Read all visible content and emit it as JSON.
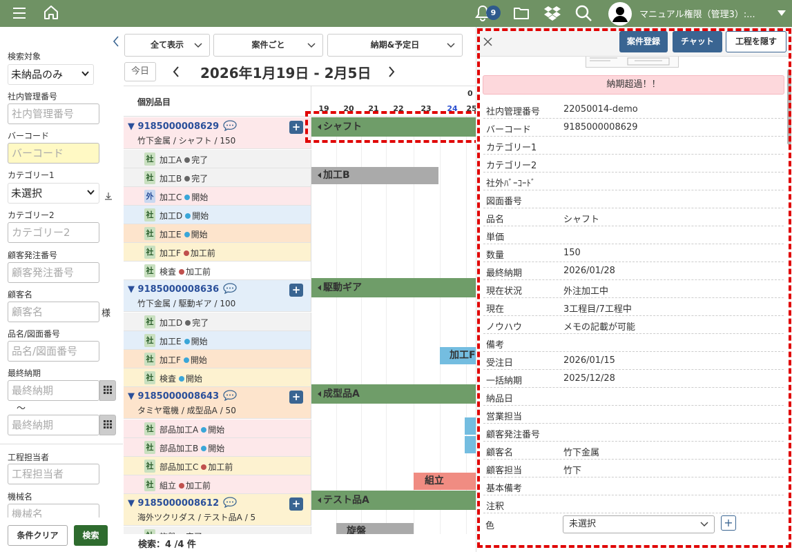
{
  "topbar": {
    "notification_count": "9",
    "user_name": "マニュアル権限（管理3）:..."
  },
  "sidebar": {
    "search_target_label": "検索対象",
    "search_target_value": "未納品のみ",
    "internal_no_label": "社内管理番号",
    "internal_no_placeholder": "社内管理番号",
    "barcode_label": "バーコード",
    "barcode_placeholder": "バーコード",
    "category1_label": "カテゴリー1",
    "category1_value": "未選択",
    "category2_label": "カテゴリー2",
    "category2_placeholder": "カテゴリー2",
    "customer_order_label": "顧客発注番号",
    "customer_order_placeholder": "顧客発注番号",
    "customer_name_label": "顧客名",
    "customer_name_placeholder": "顧客名",
    "customer_suffix": "様",
    "product_label": "品名/図面番号",
    "product_placeholder": "品名/図面番号",
    "deadline_label": "最終納期",
    "deadline_from_placeholder": "最終納期",
    "range_sep": "～",
    "deadline_to_placeholder": "最終納期",
    "process_owner_label": "工程担当者",
    "process_owner_placeholder": "工程担当者",
    "machine_label": "機械名",
    "machine_placeholder": "機械名",
    "clear_button": "条件クリア",
    "search_button": "検索"
  },
  "filters": {
    "show_all": "全て表示",
    "per_project": "案件ごと",
    "deadline_sched": "納期&予定日"
  },
  "calendar": {
    "today_button": "今日",
    "date_range": "2026年1月19日 - 2月5日",
    "days": [
      "19",
      "20",
      "21",
      "22",
      "23",
      "24",
      "25"
    ],
    "header_label": "個別品目",
    "month_hint": "0"
  },
  "gantt": {
    "products": [
      {
        "id": "9185000008629",
        "desc": "竹下金属 / シャフト / 150",
        "bar": "シャフト",
        "steps": [
          {
            "tag": "社",
            "name": "加工A",
            "status": "完了"
          },
          {
            "tag": "社",
            "name": "加工B",
            "status": "完了"
          },
          {
            "tag": "外",
            "name": "加工C",
            "status": "開始"
          },
          {
            "tag": "社",
            "name": "加工D",
            "status": "開始"
          },
          {
            "tag": "社",
            "name": "加工E",
            "status": "開始"
          },
          {
            "tag": "社",
            "name": "加工F",
            "status": "加工前"
          },
          {
            "tag": "社",
            "name": "検査",
            "status": "加工前"
          }
        ]
      },
      {
        "id": "9185000008636",
        "desc": "竹下金属 / 駆動ギア / 100",
        "bar": "駆動ギア",
        "steps": [
          {
            "tag": "社",
            "name": "加工D",
            "status": "完了"
          },
          {
            "tag": "社",
            "name": "加工E",
            "status": "開始"
          },
          {
            "tag": "社",
            "name": "加工F",
            "status": "開始"
          },
          {
            "tag": "社",
            "name": "検査",
            "status": "開始"
          }
        ]
      },
      {
        "id": "9185000008643",
        "desc": "タミヤ電機 / 成型品A / 50",
        "bar": "成型品A",
        "steps": [
          {
            "tag": "社",
            "name": "部品加工A",
            "status": "開始"
          },
          {
            "tag": "社",
            "name": "部品加工B",
            "status": "開始"
          },
          {
            "tag": "社",
            "name": "部品加工C",
            "status": "加工前"
          },
          {
            "tag": "社",
            "name": "組立",
            "status": "加工前"
          }
        ]
      },
      {
        "id": "9185000008612",
        "desc": "海外ツクリダス / テスト品A / 5",
        "bar": "テスト品A",
        "steps": [
          {
            "tag": "社",
            "name": "旋盤",
            "status": "完了"
          }
        ]
      }
    ],
    "step_bars": {
      "kakoB": "加工B",
      "kakoF": "加工F",
      "kumitate": "組立",
      "senban": "旋盤"
    },
    "status_colors": {
      "完了": "#666666",
      "開始": "#3aa6d8",
      "加工前": "#c0504d"
    },
    "search_count": "検索：4 /4 件"
  },
  "panel": {
    "register_button": "案件登録",
    "chat_button": "チャット",
    "hide_button": "工程を隠す",
    "alert": "納期超過！！",
    "fields": [
      {
        "k": "社内管理番号",
        "v": "22050014-demo"
      },
      {
        "k": "バーコード",
        "v": "9185000008629"
      },
      {
        "k": "カテゴリー1",
        "v": ""
      },
      {
        "k": "カテゴリー2",
        "v": ""
      },
      {
        "k": "社外ﾊﾞｰｺｰﾄﾞ",
        "v": ""
      },
      {
        "k": "図面番号",
        "v": ""
      },
      {
        "k": "品名",
        "v": "シャフト"
      },
      {
        "k": "単価",
        "v": ""
      },
      {
        "k": "数量",
        "v": "150"
      },
      {
        "k": "最終納期",
        "v": "2026/01/28"
      },
      {
        "k": "現在状況",
        "v": "外注加工中"
      },
      {
        "k": "現在",
        "v": "3工程目/7工程中"
      },
      {
        "k": "ノウハウ",
        "v": "メモの記載が可能"
      },
      {
        "k": "備考",
        "v": ""
      },
      {
        "k": "受注日",
        "v": "2026/01/15"
      },
      {
        "k": "一括納期",
        "v": "2025/12/28"
      },
      {
        "k": "納品日",
        "v": ""
      },
      {
        "k": "営業担当",
        "v": ""
      },
      {
        "k": "顧客発注番号",
        "v": ""
      },
      {
        "k": "顧客名",
        "v": "竹下金属"
      },
      {
        "k": "顧客担当",
        "v": "竹下"
      },
      {
        "k": "基本備考",
        "v": ""
      },
      {
        "k": "注釈",
        "v": ""
      }
    ],
    "color_label": "色",
    "color_value": "未選択"
  },
  "colors": {
    "topbar": "#6f9264",
    "accent_blue": "#3a6592",
    "highlight_red": "#e00000"
  }
}
